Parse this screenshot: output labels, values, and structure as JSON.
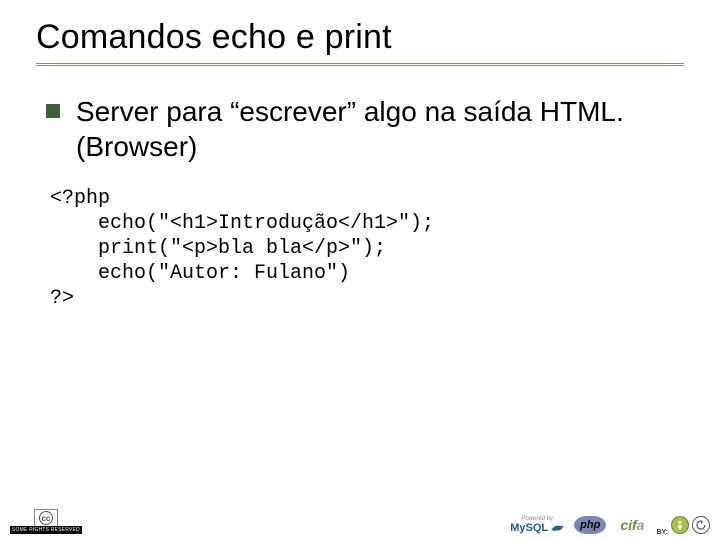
{
  "slide": {
    "title": "Comandos echo e print",
    "bullet": "Server para “escrever” algo na saída HTML. (Browser)",
    "code": "<?php\n    echo(\"<h1>Introdução</h1>\");\n    print(\"<p>bla bla</p>\");\n    echo(\"Autor: Fulano\")\n?>"
  },
  "footer": {
    "cc_label": "SOME RIGHTS RESERVED",
    "cc_mark": "cc",
    "mysql_tag": "Powered by",
    "mysql_name": "MySQL",
    "php_name": "php",
    "cifa_name_1": "cif",
    "cifa_name_2": "a",
    "by_label": "BY:"
  }
}
